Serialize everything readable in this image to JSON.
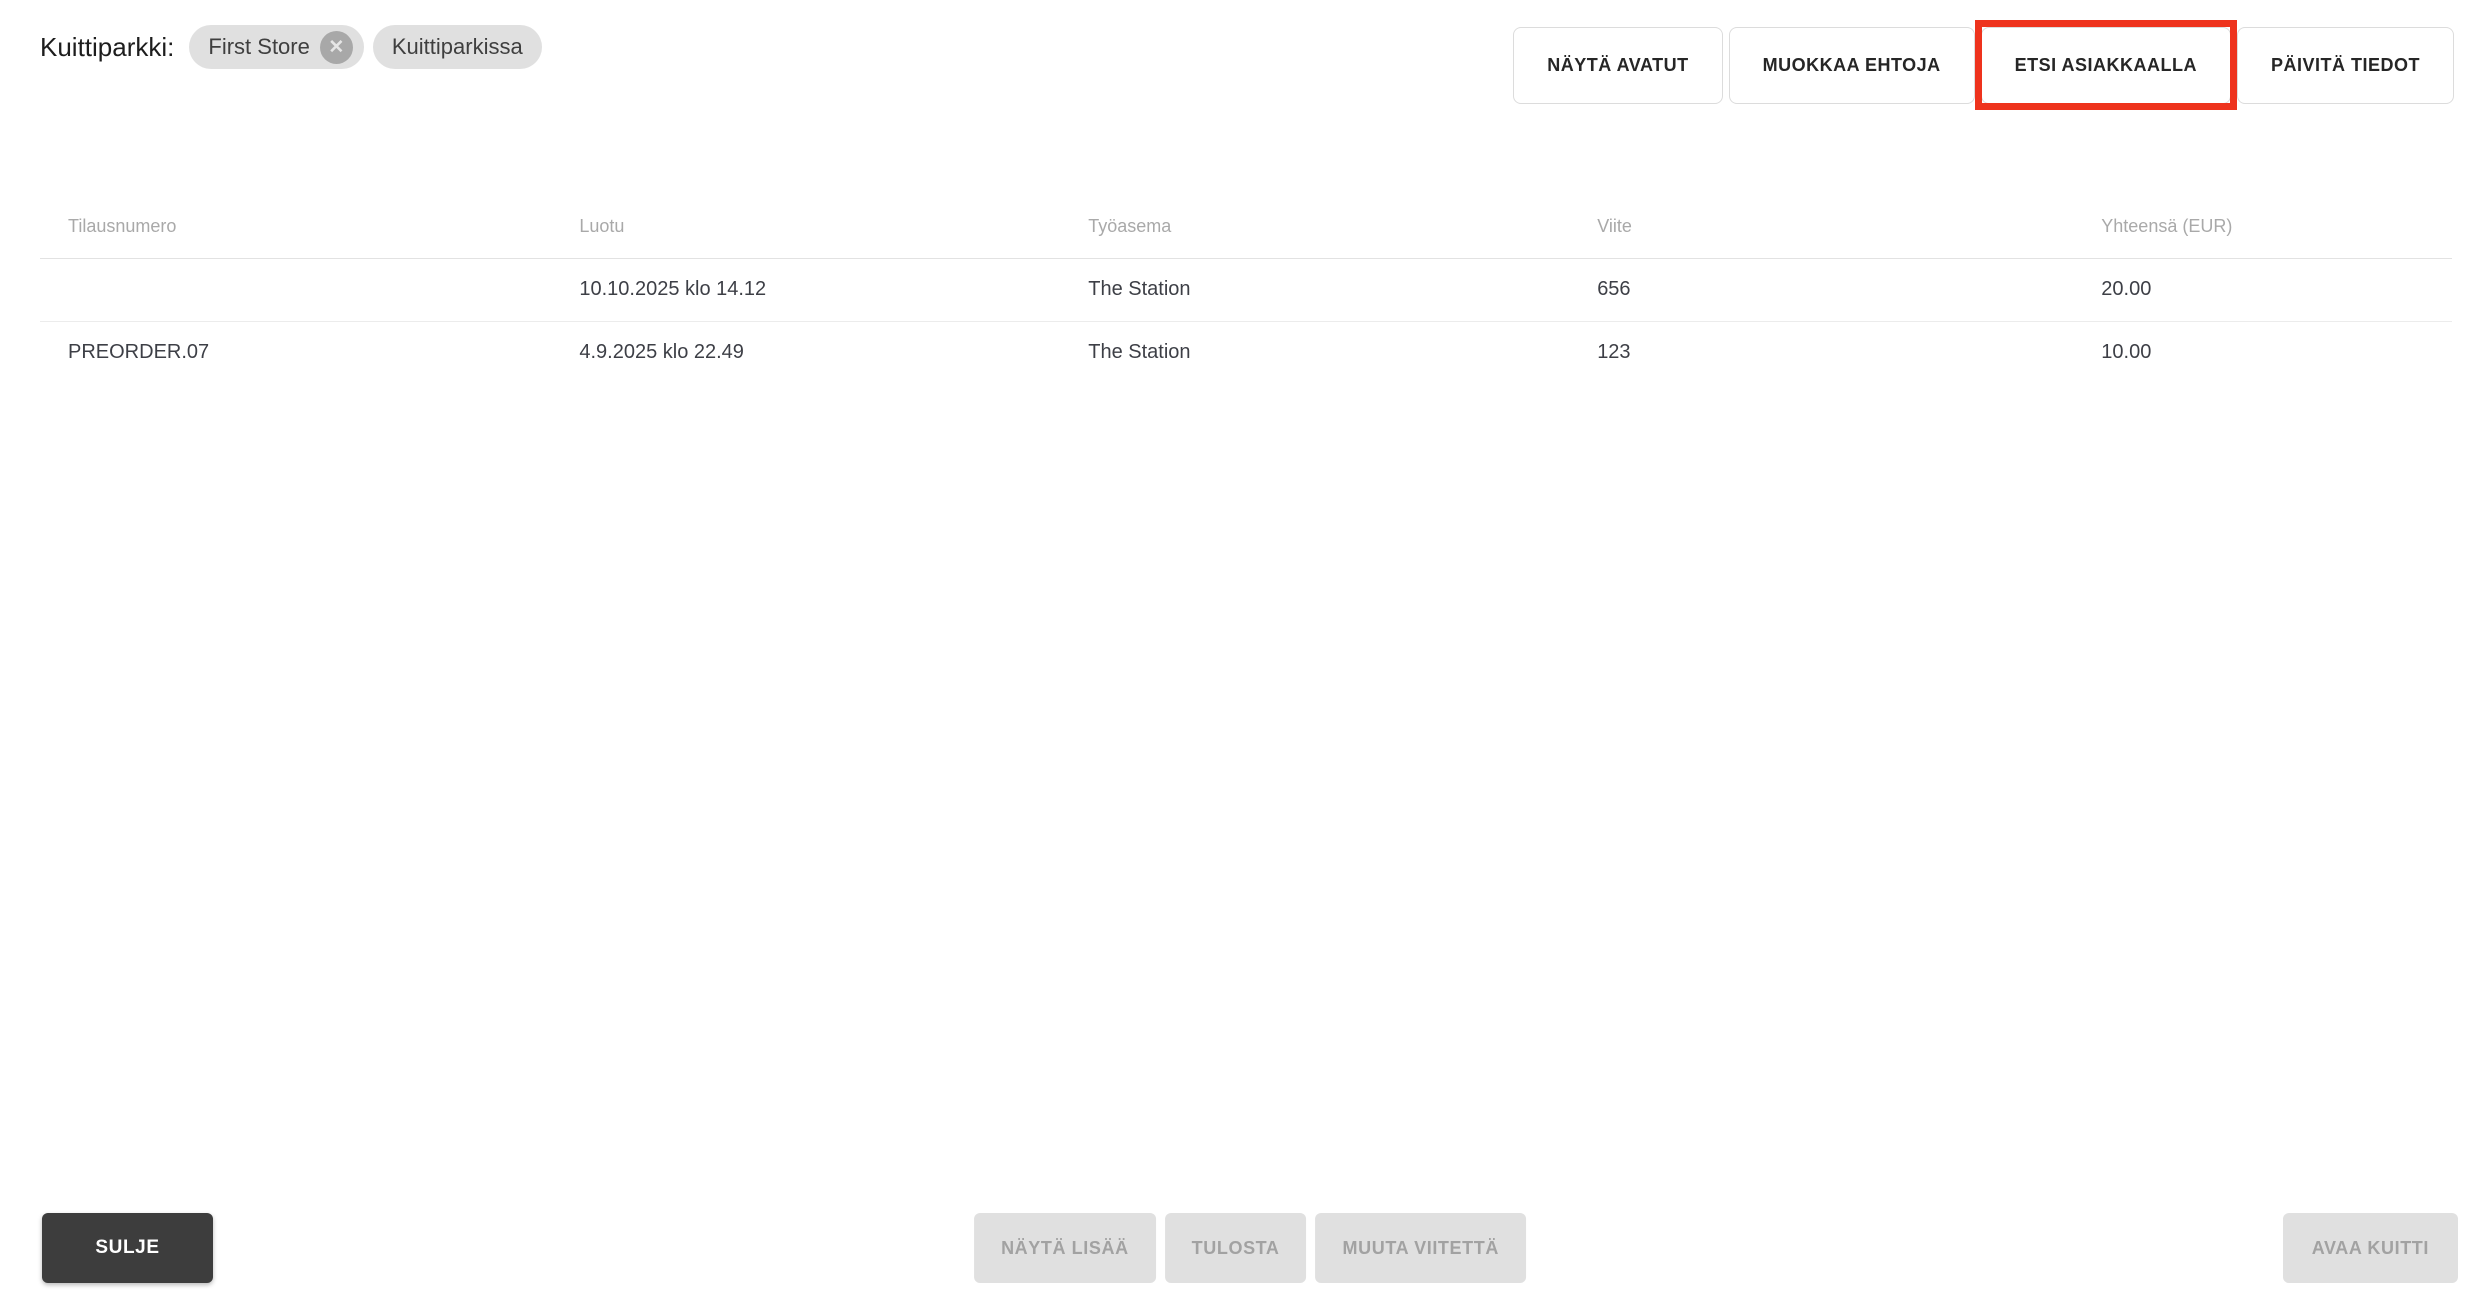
{
  "filter": {
    "label": "Kuittiparkki:",
    "chips": [
      {
        "label": "First Store",
        "removable": true
      },
      {
        "label": "Kuittiparkissa",
        "removable": false
      }
    ]
  },
  "toolbar": {
    "buttons": [
      "NÄYTÄ AVATUT",
      "MUOKKAA EHTOJA",
      "ETSI ASIAKKAALLA",
      "PÄIVITÄ TIEDOT"
    ],
    "highlighted_button": "ETSI ASIAKKAALLA"
  },
  "table": {
    "columns": [
      "Tilausnumero",
      "Luotu",
      "Työasema",
      "Viite",
      "Yhteensä (EUR)"
    ],
    "rows": [
      [
        "",
        "10.10.2025 klo 14.12",
        "The Station",
        "656",
        "20.00"
      ],
      [
        "PREORDER.07",
        "4.9.2025 klo 22.49",
        "The Station",
        "123",
        "10.00"
      ]
    ]
  },
  "footer": {
    "close_label": "SULJE",
    "disabled_buttons": [
      "NÄYTÄ LISÄÄ",
      "TULOSTA",
      "MUUTA VIITETTÄ"
    ],
    "open_receipt_label": "AVAA KUITTI"
  },
  "icons": {
    "chip_remove": "✕"
  },
  "colors": {
    "highlight_red": "#ee331d",
    "chip_bg": "#e0e0e0",
    "dark_button_bg": "#3d3d3d",
    "disabled_button_bg": "#e0e0e0",
    "disabled_button_text": "#a2a2a2",
    "header_text": "#a9a9a9",
    "body_text": "#3d3f46"
  }
}
